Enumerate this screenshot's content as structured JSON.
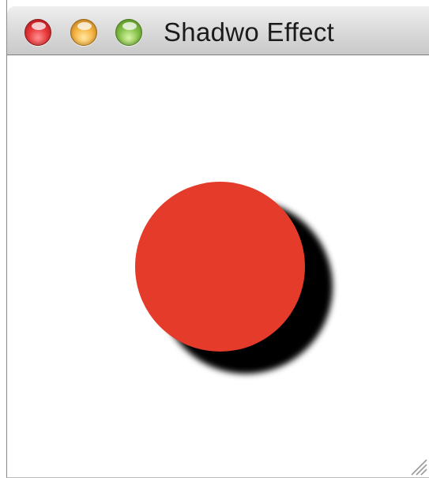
{
  "window": {
    "title": "Shadwo Effect",
    "controls": {
      "close": "close-button",
      "minimize": "minimize-button",
      "zoom": "zoom-button"
    }
  },
  "canvas": {
    "shape": "circle",
    "fill_color": "#e43b2b",
    "shadow_color": "#000000"
  }
}
